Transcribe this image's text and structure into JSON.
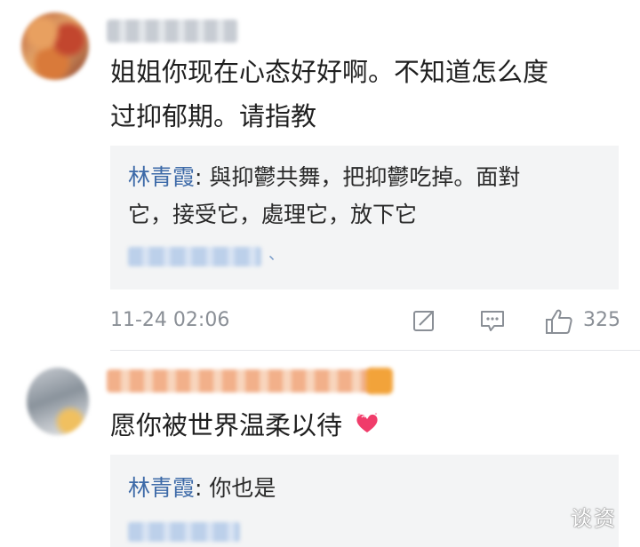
{
  "comments": [
    {
      "text_lines": [
        "姐姐你现在心态好好啊。不知道怎么度",
        "过抑郁期。请指教"
      ],
      "reply": {
        "author": "林青霞",
        "separator": ": ",
        "lines": [
          "與抑鬱共舞，把抑鬱吃掉。面對",
          "它，接受它，處理它，放下它"
        ],
        "blurred_link_suffix": "、"
      },
      "timestamp": "11-24 02:06",
      "actions": {
        "share_icon": "share-icon",
        "comment_icon": "comment-icon",
        "like_icon": "thumbs-up-icon",
        "like_count": "325"
      }
    },
    {
      "text": "愿你被世界温柔以待",
      "emoji": "heart-emoji",
      "reply": {
        "author": "林青霞",
        "separator": ": ",
        "text": "你也是"
      }
    }
  ],
  "watermark": "谈资",
  "colors": {
    "reply_author": "#3d6aa8",
    "meta_gray": "#8a8f96",
    "reply_background": "#f3f4f5"
  }
}
